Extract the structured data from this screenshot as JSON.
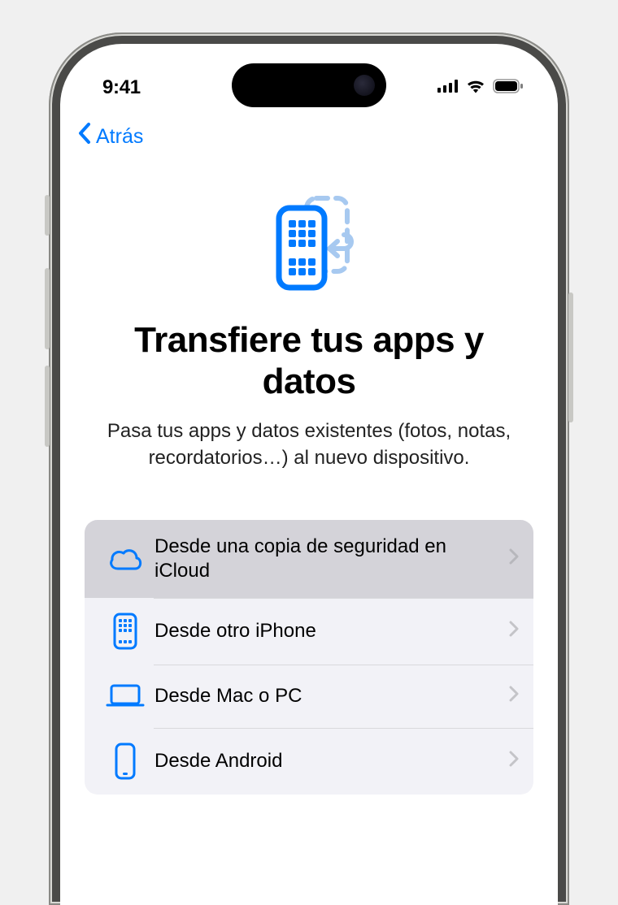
{
  "status": {
    "time": "9:41"
  },
  "nav": {
    "back_label": "Atrás"
  },
  "hero": {
    "title": "Transfiere tus apps y datos",
    "subtitle": "Pasa tus apps y datos existentes (fotos, notas, recordatorios…) al nuevo dispositivo."
  },
  "options": {
    "items": [
      {
        "label": "Desde una copia de seguridad en iCloud",
        "icon": "cloud-icon",
        "selected": true
      },
      {
        "label": "Desde otro iPhone",
        "icon": "phone-apps-icon",
        "selected": false
      },
      {
        "label": "Desde Mac o PC",
        "icon": "laptop-icon",
        "selected": false
      },
      {
        "label": "Desde Android",
        "icon": "phone-android-icon",
        "selected": false
      }
    ]
  },
  "colors": {
    "accent": "#007aff",
    "light_accent": "#a7c9f0"
  }
}
